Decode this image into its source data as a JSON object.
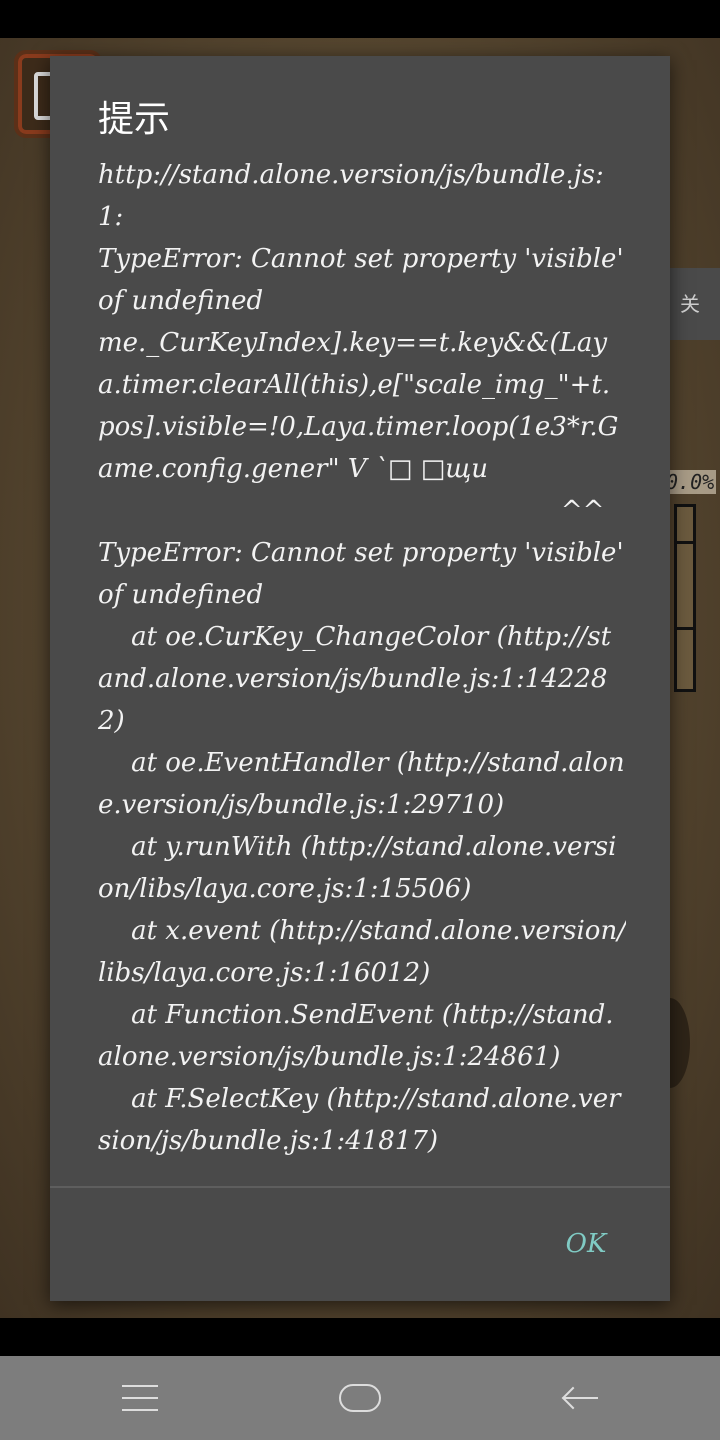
{
  "dialog": {
    "title": "提示",
    "message": "http://stand.alone.version/js/bundle.js:1:\nTypeError: Cannot set property 'visible' of undefined\nme._CurKeyIndex].key==t.key&&(Laya.timer.clearAll(this),e[\"scale_img_\"+t.pos].visible=!0,Laya.timer.loop(1e3*r.Game.config.gener\" V `□ □щu\n                                                        ^^\nTypeError: Cannot set property 'visible' of undefined\n    at oe.CurKey_ChangeColor (http://stand.alone.version/js/bundle.js:1:142282)\n    at oe.EventHandler (http://stand.alone.version/js/bundle.js:1:29710)\n    at y.runWith (http://stand.alone.version/libs/laya.core.js:1:15506)\n    at x.event (http://stand.alone.version/libs/laya.core.js:1:16012)\n    at Function.SendEvent (http://stand.alone.version/js/bundle.js:1:24861)\n    at F.SelectKey (http://stand.alone.version/js/bundle.js:1:41817)",
    "ok_label": "OK"
  },
  "game": {
    "side_label": "关",
    "percent_label": "0.0%"
  },
  "icons": {
    "menu": "menu-icon",
    "home": "home-icon",
    "back": "back-arrow-icon"
  },
  "colors": {
    "dialog_bg": "#4a4a4a",
    "ok_accent": "#80cbc4",
    "nav_bar": "#7d7d7d"
  }
}
